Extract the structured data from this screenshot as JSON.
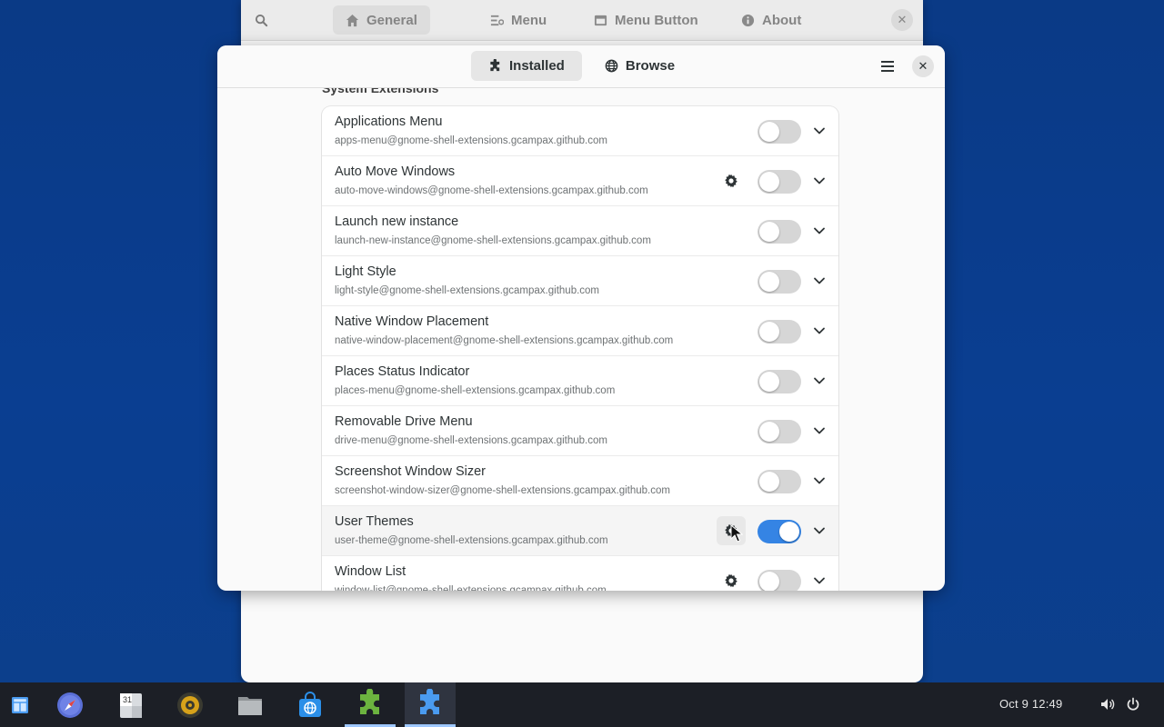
{
  "back_window": {
    "tabs": [
      {
        "label": "General",
        "icon": "home-icon",
        "active": true
      },
      {
        "label": "Menu",
        "icon": "menu-list-icon",
        "active": false
      },
      {
        "label": "Menu Button",
        "icon": "window-icon",
        "active": false
      },
      {
        "label": "About",
        "icon": "info-icon",
        "active": false
      }
    ],
    "search_icon": "search-icon",
    "close_icon": "close-icon"
  },
  "front_window": {
    "view_switcher": [
      {
        "label": "Installed",
        "icon": "puzzle-icon",
        "active": true
      },
      {
        "label": "Browse",
        "icon": "globe-icon",
        "active": false
      }
    ],
    "menu_icon": "hamburger-icon",
    "close_icon": "close-icon",
    "section_title": "System Extensions",
    "extensions": [
      {
        "name": "Applications Menu",
        "uuid": "apps-menu@gnome-shell-extensions.gcampax.github.com",
        "enabled": false,
        "has_settings": false
      },
      {
        "name": "Auto Move Windows",
        "uuid": "auto-move-windows@gnome-shell-extensions.gcampax.github.com",
        "enabled": false,
        "has_settings": true
      },
      {
        "name": "Launch new instance",
        "uuid": "launch-new-instance@gnome-shell-extensions.gcampax.github.com",
        "enabled": false,
        "has_settings": false
      },
      {
        "name": "Light Style",
        "uuid": "light-style@gnome-shell-extensions.gcampax.github.com",
        "enabled": false,
        "has_settings": false
      },
      {
        "name": "Native Window Placement",
        "uuid": "native-window-placement@gnome-shell-extensions.gcampax.github.com",
        "enabled": false,
        "has_settings": false
      },
      {
        "name": "Places Status Indicator",
        "uuid": "places-menu@gnome-shell-extensions.gcampax.github.com",
        "enabled": false,
        "has_settings": false
      },
      {
        "name": "Removable Drive Menu",
        "uuid": "drive-menu@gnome-shell-extensions.gcampax.github.com",
        "enabled": false,
        "has_settings": false
      },
      {
        "name": "Screenshot Window Sizer",
        "uuid": "screenshot-window-sizer@gnome-shell-extensions.gcampax.github.com",
        "enabled": false,
        "has_settings": false
      },
      {
        "name": "User Themes",
        "uuid": "user-theme@gnome-shell-extensions.gcampax.github.com",
        "enabled": true,
        "has_settings": true,
        "hovered": true
      },
      {
        "name": "Window List",
        "uuid": "window-list@gnome-shell-extensions.gcampax.github.com",
        "enabled": false,
        "has_settings": true
      }
    ]
  },
  "taskbar": {
    "apps": [
      {
        "name": "activities",
        "icon": "app-grid-icon"
      },
      {
        "name": "web-browser",
        "icon": "compass-icon"
      },
      {
        "name": "calendar",
        "icon": "calendar-icon",
        "day": "31"
      },
      {
        "name": "music",
        "icon": "speaker-icon"
      },
      {
        "name": "files",
        "icon": "folder-icon"
      },
      {
        "name": "software",
        "icon": "shopping-bag-icon"
      },
      {
        "name": "extension-manager",
        "icon": "puzzle-green-icon",
        "running": true
      },
      {
        "name": "extensions",
        "icon": "puzzle-blue-icon",
        "running": true,
        "active": true
      }
    ],
    "clock": "Oct 9  12:49",
    "tray": [
      {
        "icon": "volume-icon"
      },
      {
        "icon": "power-icon"
      }
    ]
  },
  "colors": {
    "desktop": "#0b3f8f",
    "accent": "#3584e4",
    "taskbar": "#1c1f26"
  }
}
